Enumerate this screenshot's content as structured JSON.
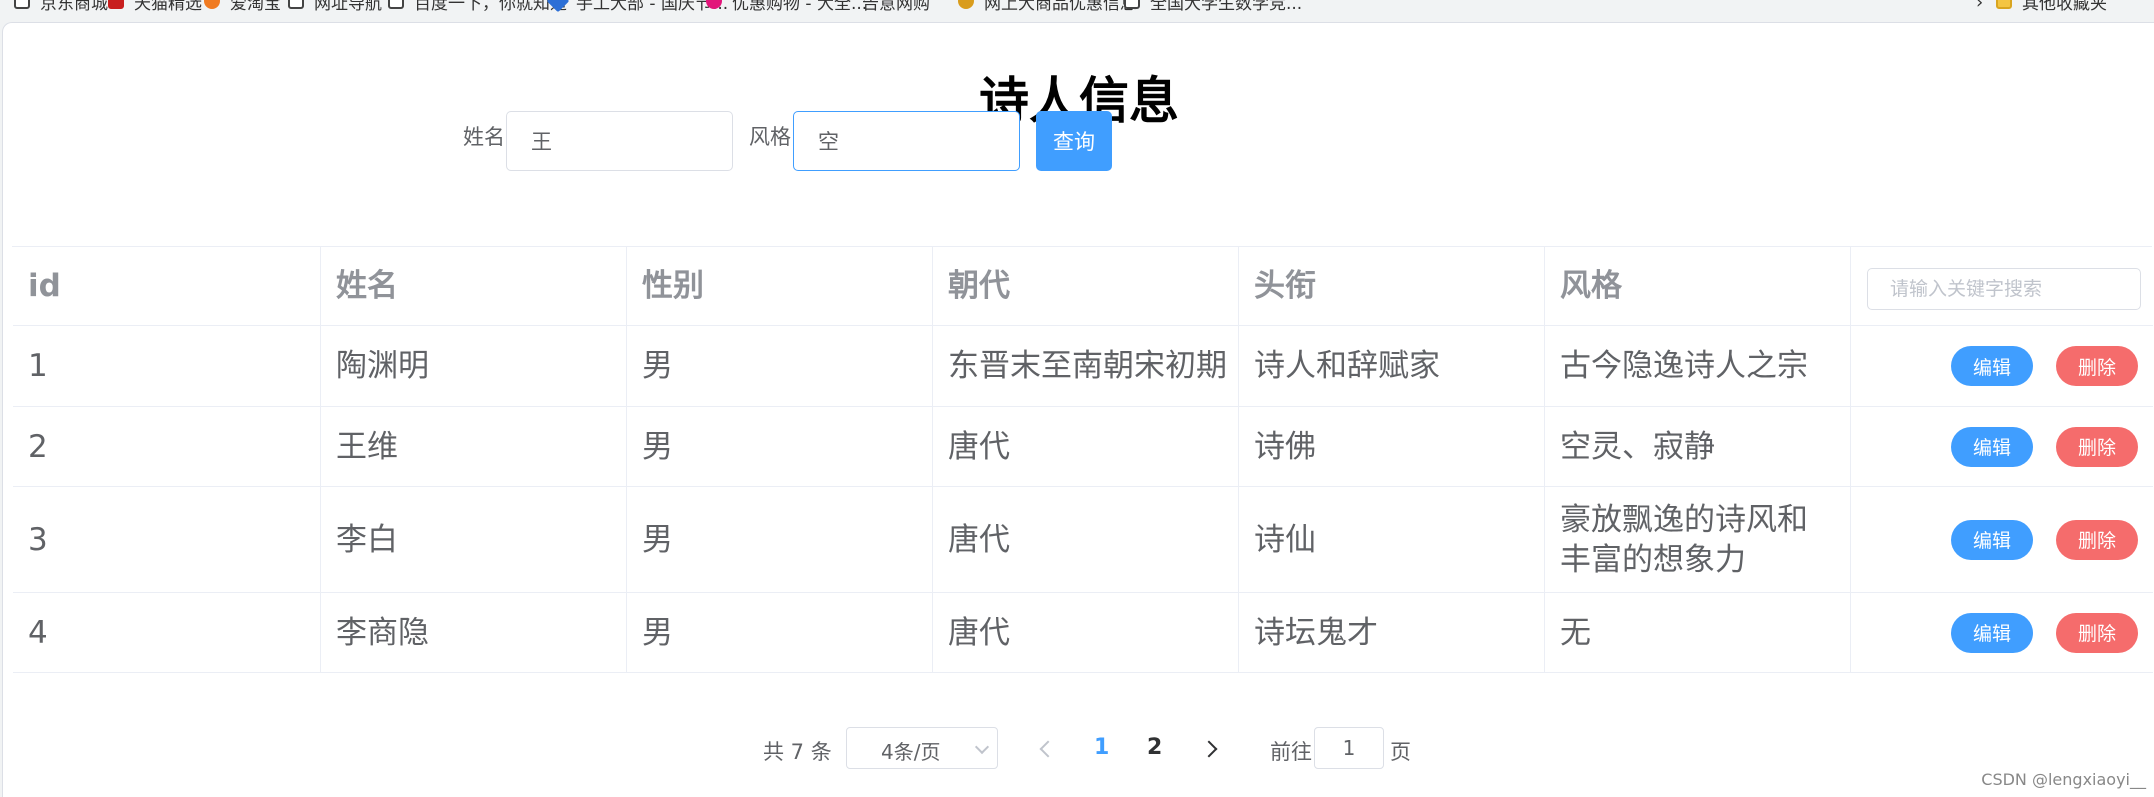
{
  "bookmarks": [
    {
      "label": "京东商城",
      "icon": "page-icon"
    },
    {
      "label": "天猫精选",
      "icon": "tmall-icon"
    },
    {
      "label": "爱淘宝",
      "icon": "taobao-icon"
    },
    {
      "label": "网址导航",
      "icon": "page-icon"
    },
    {
      "label": "百度一下，你就知道",
      "icon": "page-icon"
    },
    {
      "label": "手工大部 - 国庆节...",
      "icon": "shield-icon"
    },
    {
      "label": "优惠购物 - 大全...",
      "icon": "shop-icon"
    },
    {
      "label": "告意网购",
      "icon": "dots-icon"
    },
    {
      "label": "网上大商品优惠信息",
      "icon": "coin-icon"
    },
    {
      "label": "全国大学生数学竞...",
      "icon": "page-icon"
    },
    {
      "label": "其他收藏夹",
      "icon": "folder-icon"
    }
  ],
  "page_title": "诗人信息",
  "search": {
    "name_label": "姓名",
    "name_value": "王",
    "style_label": "风格",
    "style_value": "空",
    "query_button": "查询"
  },
  "table": {
    "headers": [
      "id",
      "姓名",
      "性别",
      "朝代",
      "头衔",
      "风格"
    ],
    "keyword_placeholder": "请输入关键字搜索",
    "edit_label": "编辑",
    "delete_label": "删除",
    "rows": [
      {
        "id": "1",
        "name": "陶渊明",
        "gender": "男",
        "dynasty": "东晋末至南朝宋初期",
        "title": "诗人和辞赋家",
        "style": "古今隐逸诗人之宗"
      },
      {
        "id": "2",
        "name": "王维",
        "gender": "男",
        "dynasty": "唐代",
        "title": "诗佛",
        "style": "空灵、寂静"
      },
      {
        "id": "3",
        "name": "李白",
        "gender": "男",
        "dynasty": "唐代",
        "title": "诗仙",
        "style": "豪放飘逸的诗风和丰富的想象力"
      },
      {
        "id": "4",
        "name": "李商隐",
        "gender": "男",
        "dynasty": "唐代",
        "title": "诗坛鬼才",
        "style": "无"
      }
    ]
  },
  "pagination": {
    "total_text": "共 7 条",
    "page_size": "4条/页",
    "pages": [
      "1",
      "2"
    ],
    "current_page": "1",
    "goto_prefix": "前往",
    "goto_value": "1",
    "goto_suffix": "页"
  },
  "watermark": "CSDN @lengxiaoyi__",
  "colors": {
    "primary": "#409eff",
    "danger": "#f56c6c",
    "border": "#ebeef5",
    "header_text": "#909399"
  }
}
